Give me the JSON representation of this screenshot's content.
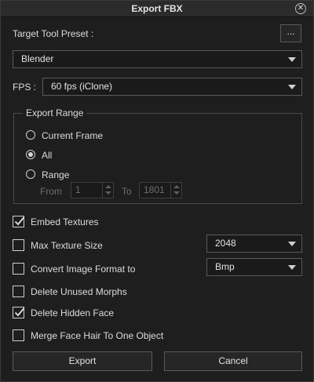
{
  "window": {
    "title": "Export FBX"
  },
  "target_preset": {
    "label": "Target Tool Preset :",
    "dots_label": "...",
    "value": "Blender"
  },
  "fps": {
    "label": "FPS :",
    "value": "60 fps (iClone)"
  },
  "export_range": {
    "legend": "Export Range",
    "options": [
      {
        "label": "Current Frame",
        "checked": false
      },
      {
        "label": "All",
        "checked": true
      },
      {
        "label": "Range",
        "checked": false
      }
    ],
    "from_label": "From",
    "from_value": "1",
    "to_label": "To",
    "to_value": "1801"
  },
  "options": {
    "embed_textures": {
      "label": "Embed Textures",
      "checked": true
    },
    "max_texture_size": {
      "label": "Max Texture Size",
      "checked": false,
      "value": "2048"
    },
    "convert_image_format": {
      "label": "Convert Image Format to",
      "checked": false,
      "value": "Bmp"
    },
    "delete_unused_morphs": {
      "label": "Delete Unused Morphs",
      "checked": false
    },
    "delete_hidden_face": {
      "label": "Delete Hidden Face",
      "checked": true
    },
    "merge_face_hair": {
      "label": "Merge Face Hair To One Object",
      "checked": false
    }
  },
  "buttons": {
    "export": "Export",
    "cancel": "Cancel"
  },
  "colors": {
    "background": "#1e1e1e",
    "titlebar": "#2b2b2b",
    "border": "#5a5a5a",
    "text": "#dcdcdc"
  }
}
